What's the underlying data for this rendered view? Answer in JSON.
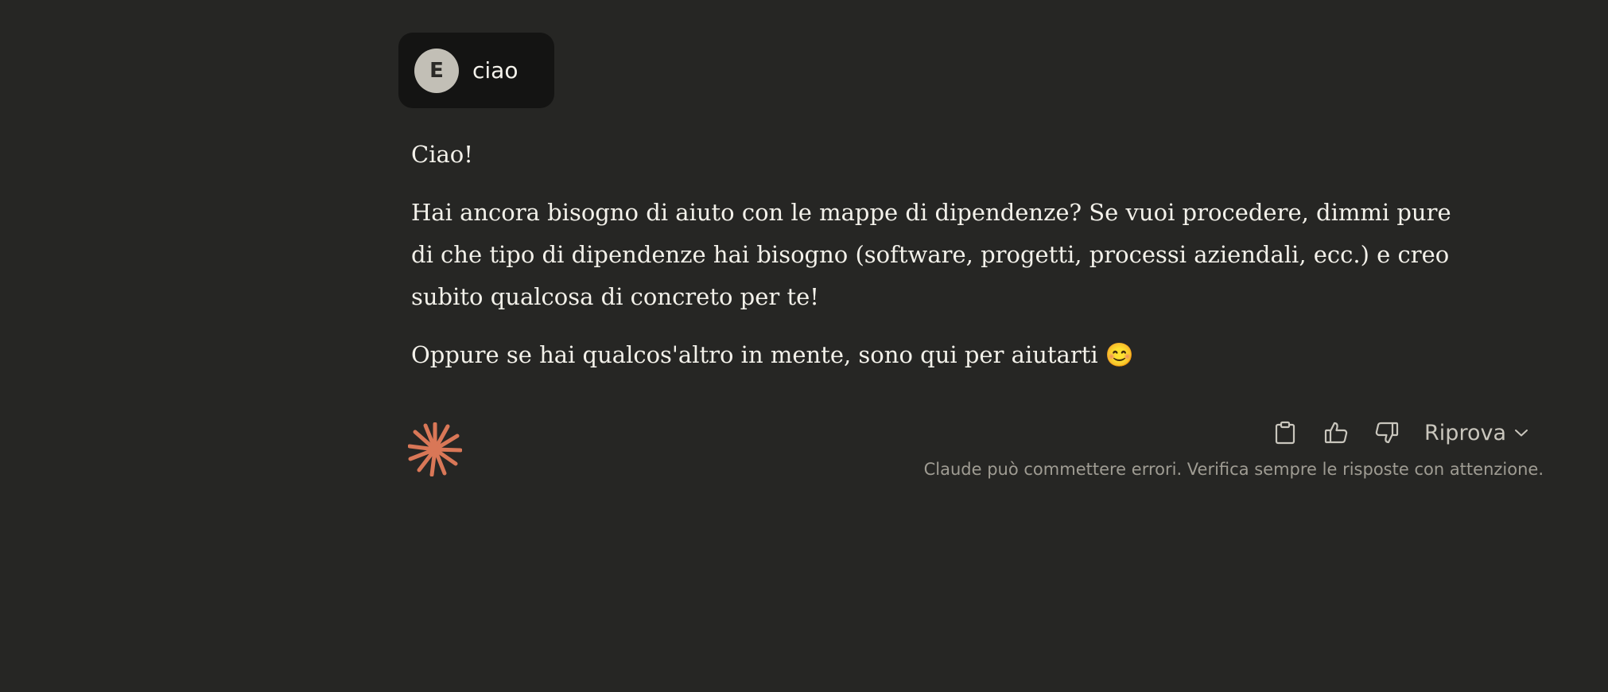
{
  "user_message": {
    "avatar_initial": "E",
    "text": "ciao"
  },
  "assistant_message": {
    "paragraphs": [
      "Ciao!",
      "Hai ancora bisogno di aiuto con le mappe di dipendenze? Se vuoi procedere, dimmi pure di che tipo di dipendenze hai bisogno (software, progetti, processi aziendali, ecc.) e creo subito qualcosa di concreto per te!",
      "Oppure se hai qualcos'altro in mente, sono qui per aiutarti 😊"
    ]
  },
  "actions": {
    "copy_icon": "clipboard-icon",
    "like_icon": "thumbs-up-icon",
    "dislike_icon": "thumbs-down-icon",
    "retry_label": "Riprova",
    "retry_icon": "chevron-down-icon"
  },
  "disclaimer": "Claude può commettere errori. Verifica sempre le risposte con attenzione.",
  "colors": {
    "background": "#262624",
    "user_bubble": "#141413",
    "avatar": "#c2bfb6",
    "logo_accent": "#d97757"
  }
}
